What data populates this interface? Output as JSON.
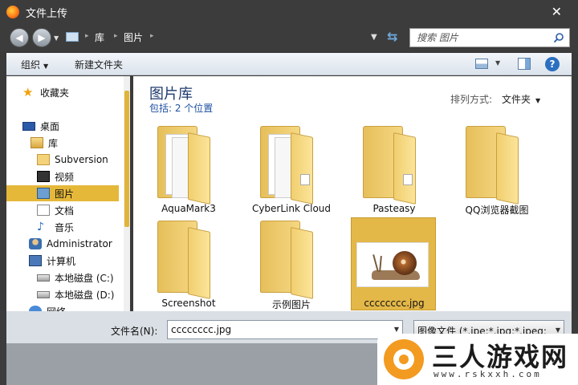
{
  "window": {
    "title": "文件上传"
  },
  "address": {
    "crumbs": [
      "库",
      "图片"
    ],
    "search_placeholder": "搜索 图片"
  },
  "toolbar": {
    "organize": "组织",
    "new_folder": "新建文件夹"
  },
  "nav": {
    "favorites": "收藏夹",
    "desktop": "桌面",
    "libraries": "库",
    "subversion": "Subversion",
    "videos": "视频",
    "pictures": "图片",
    "documents": "文档",
    "music": "音乐",
    "admin": "Administrator",
    "computer": "计算机",
    "drive_c": "本地磁盘 (C:)",
    "drive_d": "本地磁盘 (D:)",
    "network": "网络"
  },
  "content": {
    "title": "图片库",
    "subtitle": "包括: 2 个位置",
    "sort_label": "排列方式:",
    "sort_value": "文件夹",
    "items": [
      {
        "label": "AquaMark3",
        "kind": "folder"
      },
      {
        "label": "CyberLink Cloud",
        "kind": "folder"
      },
      {
        "label": "Pasteasy",
        "kind": "folder"
      },
      {
        "label": "QQ浏览器截图",
        "kind": "folder"
      },
      {
        "label": "Screenshot",
        "kind": "folder"
      },
      {
        "label": "示例图片",
        "kind": "folder"
      },
      {
        "label": "cccccccc.jpg",
        "kind": "image"
      }
    ]
  },
  "footer": {
    "filename_label": "文件名(N):",
    "filename_value": "cccccccc.jpg",
    "filetype_value": "图像文件 (*.jpe;*.jpg;*.jpeg;*.g"
  },
  "watermark": {
    "title": "三人游戏网",
    "url": "www.rskxxh.com"
  }
}
